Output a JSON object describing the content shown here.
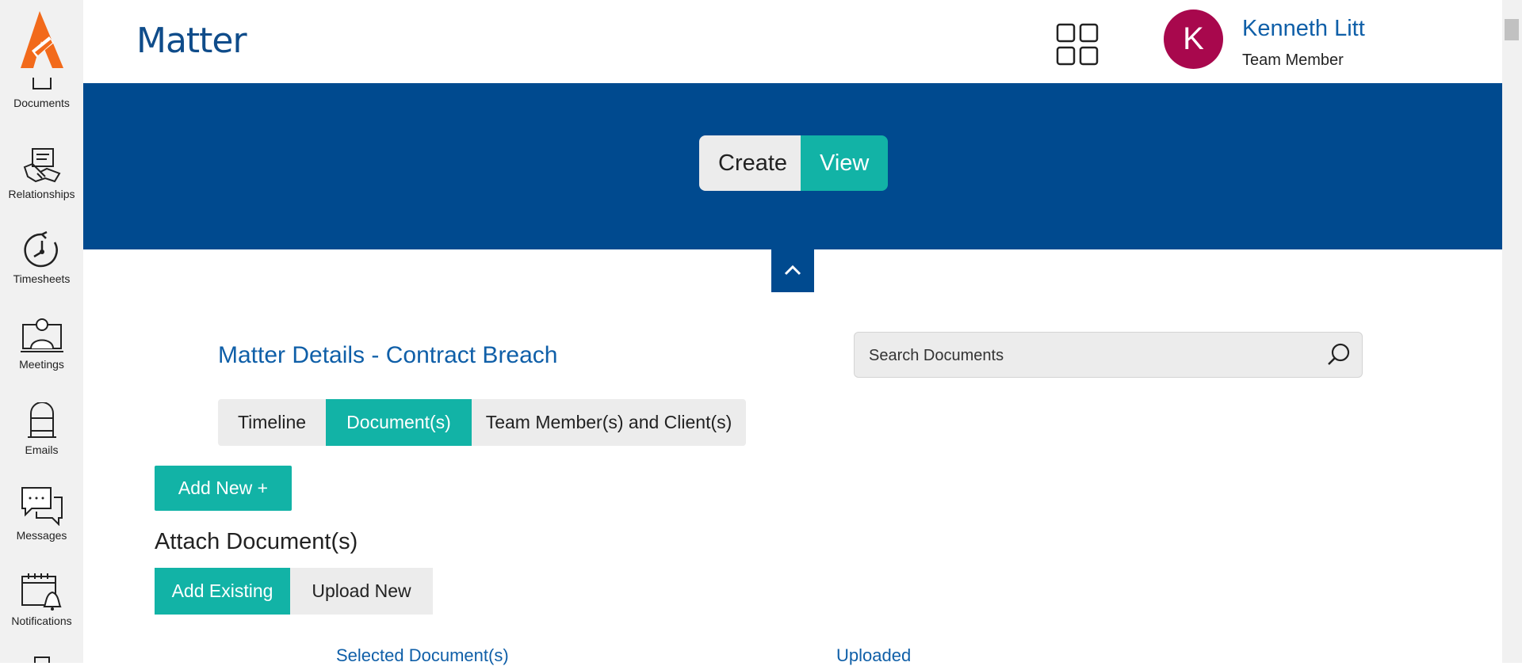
{
  "sidebar": {
    "items": [
      {
        "label": "Documents",
        "icon": "document-icon"
      },
      {
        "label": "Relationships",
        "icon": "handshake-icon"
      },
      {
        "label": "Timesheets",
        "icon": "clock-icon"
      },
      {
        "label": "Meetings",
        "icon": "meeting-icon"
      },
      {
        "label": "Emails",
        "icon": "mailbox-icon"
      },
      {
        "label": "Messages",
        "icon": "chat-icon"
      },
      {
        "label": "Notifications",
        "icon": "calendar-bell-icon"
      }
    ]
  },
  "header": {
    "title": "Matter",
    "user": {
      "initial": "K",
      "name": "Kenneth Litt",
      "role": "Team Member"
    }
  },
  "banner": {
    "toggle": {
      "create": "Create",
      "view": "View",
      "active": "View"
    }
  },
  "matter": {
    "title": "Matter Details - Contract Breach",
    "search_placeholder": "Search Documents",
    "tabs": [
      {
        "label": "Timeline",
        "active": false
      },
      {
        "label": "Document(s)",
        "active": true
      },
      {
        "label": "Team Member(s) and Client(s)",
        "active": false
      }
    ],
    "add_new_label": "Add New +",
    "attach_title": "Attach Document(s)",
    "attach_options": {
      "existing": "Add Existing",
      "upload": "Upload New",
      "active": "Add Existing"
    },
    "columns": {
      "selected": "Selected Document(s)",
      "uploaded": "Uploaded"
    }
  },
  "colors": {
    "brand_blue": "#004a8f",
    "teal": "#12b3a6",
    "link_blue": "#0f5fa8",
    "avatar": "#a8084d",
    "logo_orange": "#f26a1b"
  }
}
